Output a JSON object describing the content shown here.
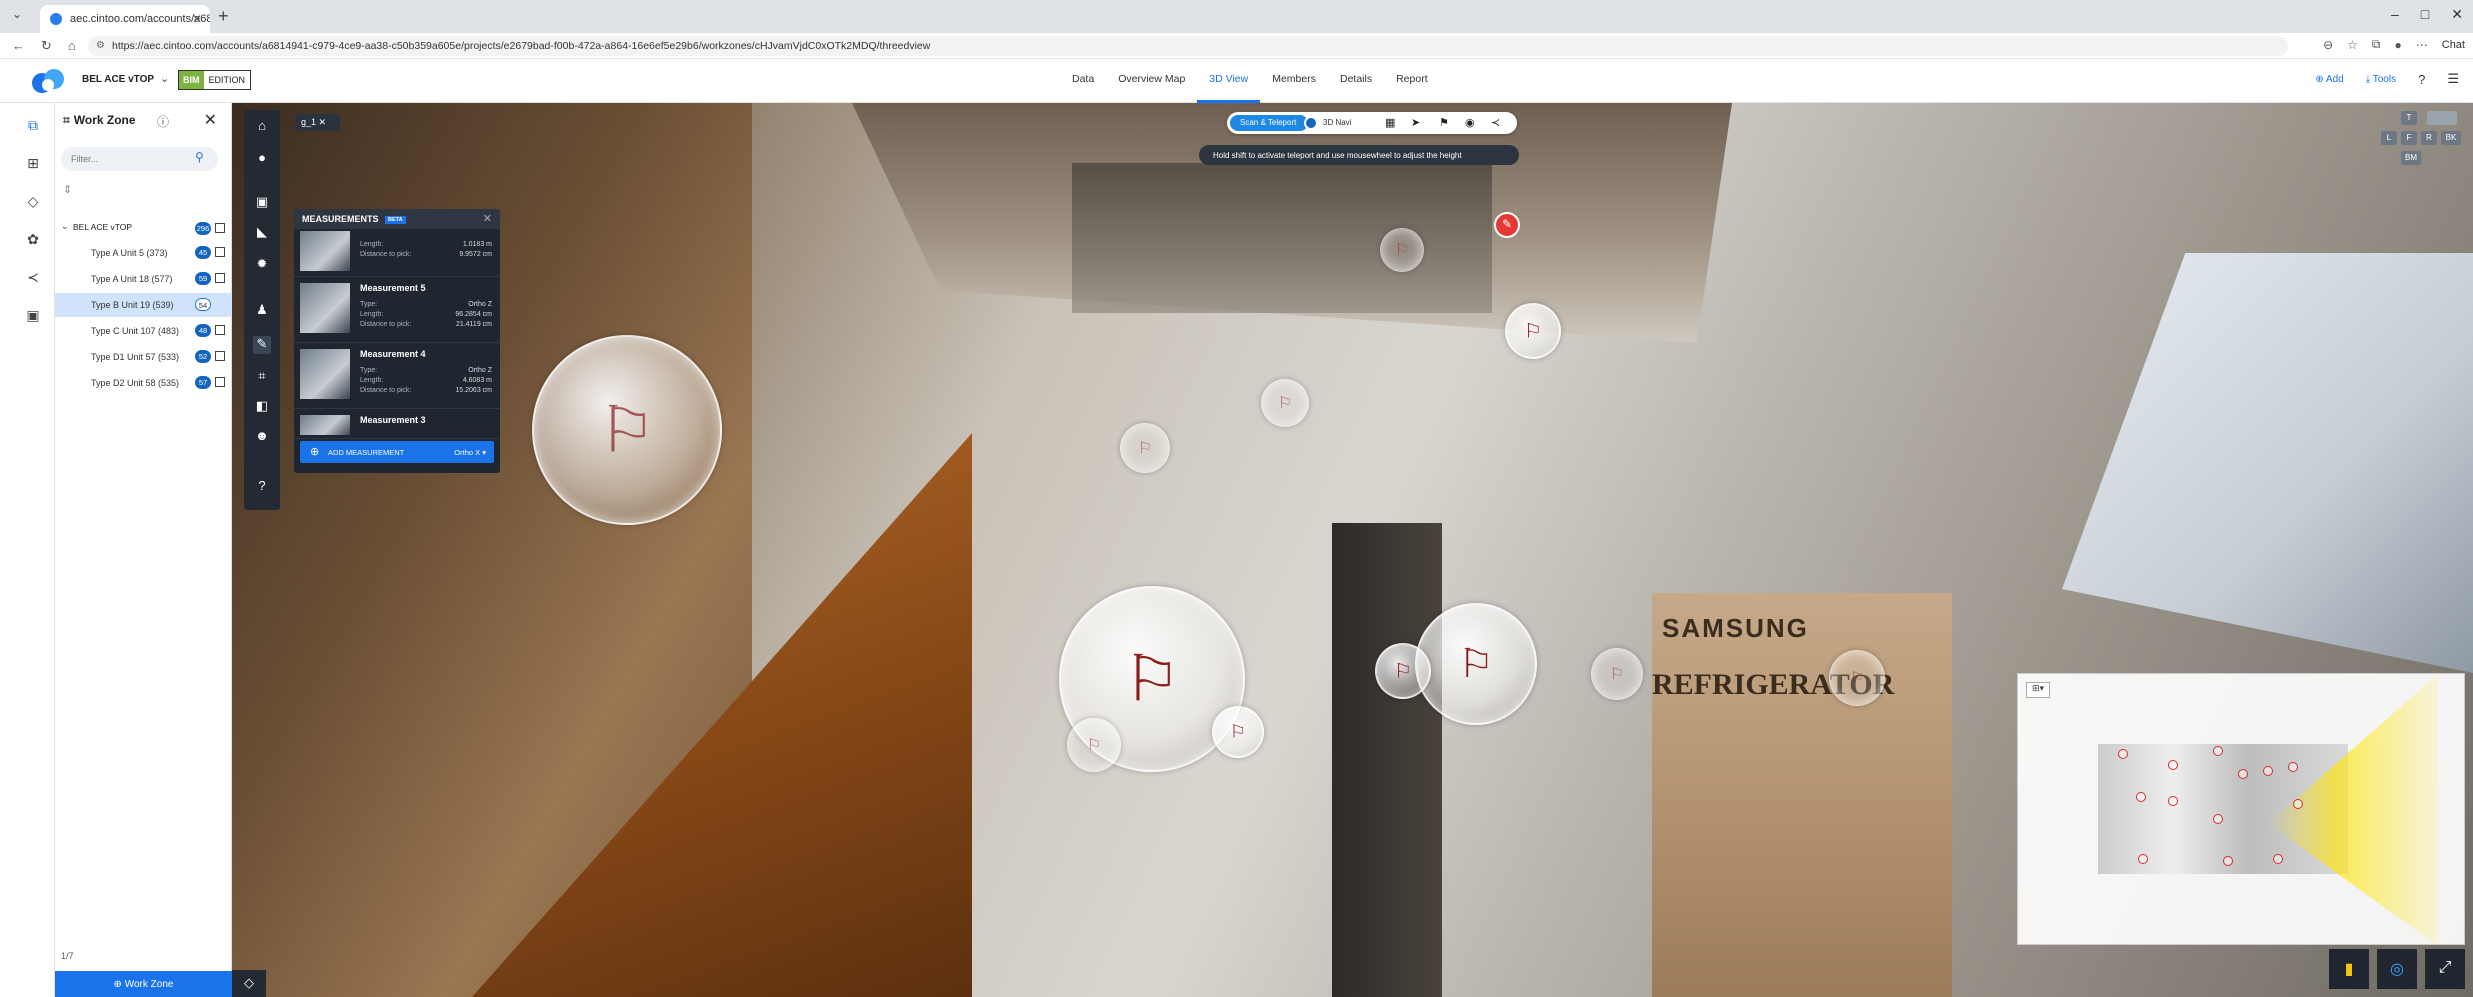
{
  "browser": {
    "tab_title": "aec.cintoo.com/accounts/a6814...",
    "url": "https://aec.cintoo.com/accounts/a6814941-c979-4ce9-aa38-c50b359a605e/projects/e2679bad-f00b-472a-a864-16e6ef5e29b6/workzones/cHJvamVjdC0xOTk2MDQ/threedview",
    "new_tab": "+",
    "chat_label": "Chat",
    "window_controls": [
      "–",
      "□",
      "✕"
    ]
  },
  "app": {
    "project_name": "BEL ACE vTOP",
    "edition_badge": "BIM",
    "edition_label": "EDITION",
    "nav": [
      "Data",
      "Overview Map",
      "3D View",
      "Members",
      "Details",
      "Report"
    ],
    "active_nav": "3D View",
    "add_label": "Add",
    "tools_label": "Tools"
  },
  "workzone_panel": {
    "title": "Work Zone",
    "filter_placeholder": "Filter...",
    "root": {
      "label": "BEL ACE vTOP",
      "count": "296"
    },
    "items": [
      {
        "label": "Type A Unit 5 (373)",
        "count": "45"
      },
      {
        "label": "Type A Unit 18 (577)",
        "count": "59"
      },
      {
        "label": "Type B Unit 19 (539)",
        "count": "54",
        "selected": true
      },
      {
        "label": "Type C Unit 107 (483)",
        "count": "48"
      },
      {
        "label": "Type D1 Unit 57 (533)",
        "count": "52"
      },
      {
        "label": "Type D2 Unit 58 (535)",
        "count": "57"
      }
    ],
    "pager": "1/7",
    "button_label": "Work Zone"
  },
  "viewport": {
    "scan_chip": "g_1",
    "mode_active": "Scan & Teleport",
    "mode_other": "3D Navi",
    "hint": "Hold shift to activate teleport and use mousewheel to adjust the height",
    "navcube": [
      "T",
      "L",
      "F",
      "R",
      "BK",
      "BM"
    ],
    "brand_text": "SAMSUNG",
    "box_text": "REFRIGERATOR"
  },
  "measurements": {
    "title": "MEASUREMENTS",
    "beta": "BETA",
    "top_partial": {
      "length_label": "Length:",
      "length": "1.0183 m",
      "dist_label": "Distance to pick:",
      "dist": "9.9572 cm"
    },
    "items": [
      {
        "name": "Measurement 5",
        "type_label": "Type:",
        "type": "Ortho Z",
        "length_label": "Length:",
        "length": "96.2854 cm",
        "dist_label": "Distance to pick:",
        "dist": "21.4119 cm"
      },
      {
        "name": "Measurement 4",
        "type_label": "Type:",
        "type": "Ortho Z",
        "length_label": "Length:",
        "length": "4.6083 m",
        "dist_label": "Distance to pick:",
        "dist": "15.2063 cm"
      },
      {
        "name": "Measurement 3"
      }
    ],
    "add_label": "ADD MEASUREMENT",
    "ortho_label": "Ortho X"
  },
  "colors": {
    "accent": "#1a73e8",
    "dark_panel": "#1f2630",
    "scan_red": "#8b1a1a"
  }
}
